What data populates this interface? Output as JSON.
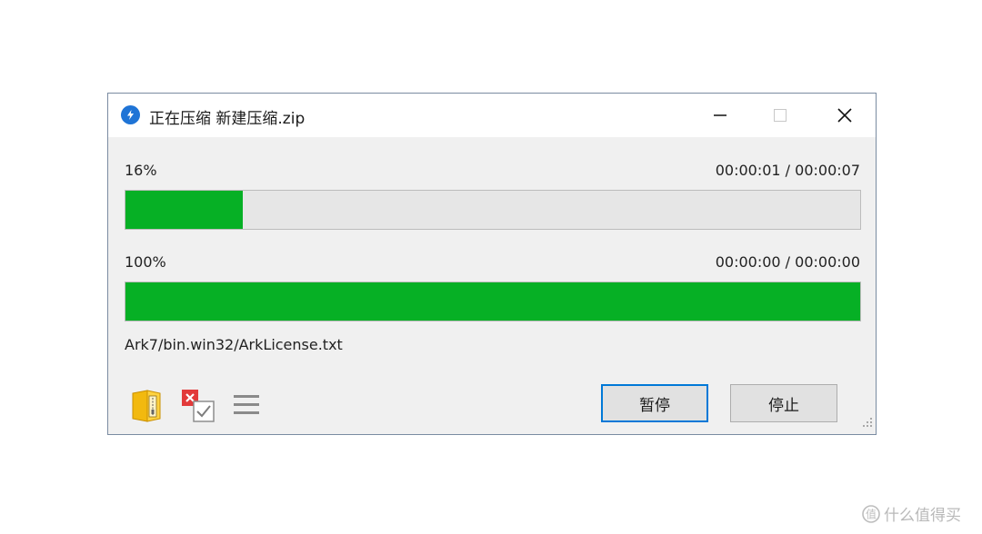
{
  "window": {
    "title": "正在压缩 新建压缩.zip"
  },
  "overall": {
    "percent_label": "16%",
    "time": "00:00:01 / 00:00:07",
    "progress_fraction": 0.16
  },
  "file": {
    "percent_label": "100%",
    "time": "00:00:00 / 00:00:00",
    "progress_fraction": 1.0
  },
  "current_file": "Ark7/bin.win32/ArkLicense.txt",
  "buttons": {
    "pause": "暂停",
    "stop": "停止"
  },
  "icons": {
    "app": "app-logo-icon",
    "open_folder": "open-folder-icon",
    "close_when_done": "close-when-done-checkbox-icon",
    "menu": "hamburger-menu-icon"
  },
  "watermark": "什么值得买",
  "colors": {
    "progress_fill": "#06b025",
    "progress_track": "#e6e6e6",
    "default_button_border": "#0078d7"
  }
}
